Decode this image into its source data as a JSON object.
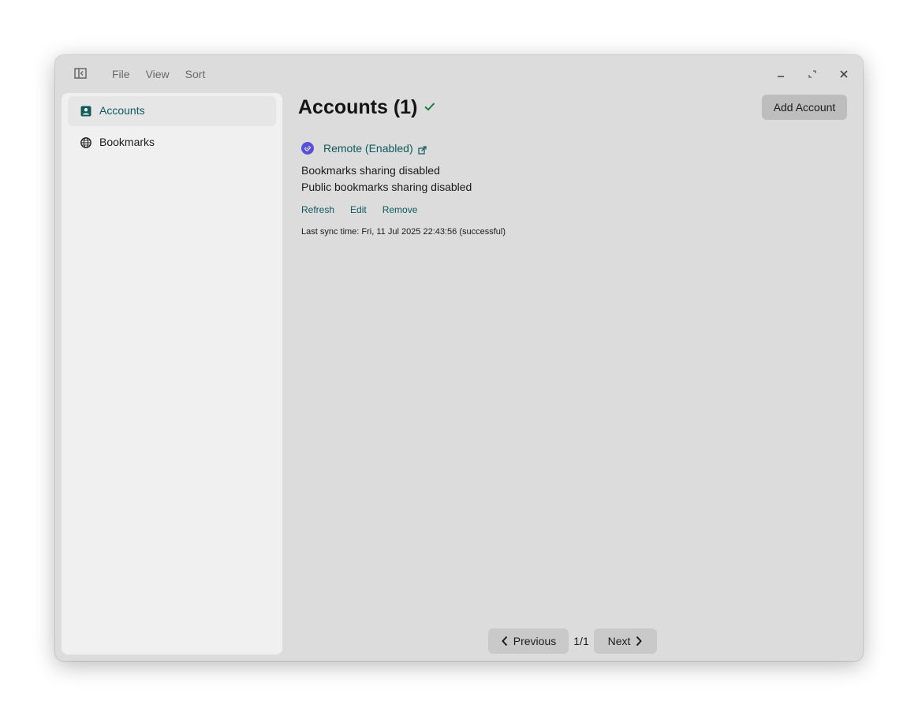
{
  "menu": {
    "items": [
      "File",
      "View",
      "Sort"
    ]
  },
  "sidebar": {
    "items": [
      {
        "label": "Accounts",
        "icon": "account-box-icon",
        "active": true
      },
      {
        "label": "Bookmarks",
        "icon": "globe-icon",
        "active": false
      }
    ]
  },
  "main": {
    "title": "Accounts (1)",
    "add_account_label": "Add Account",
    "account": {
      "name": "Remote (Enabled)",
      "icon": "link-icon",
      "bookmarks_sharing": "Bookmarks sharing disabled",
      "public_bookmarks_sharing": "Public bookmarks sharing disabled",
      "actions": [
        "Refresh",
        "Edit",
        "Remove"
      ],
      "last_sync": "Last sync time: Fri, 11 Jul 2025 22:43:56 (successful)"
    }
  },
  "pagination": {
    "previous_label": "Previous",
    "page_indicator": "1/1",
    "next_label": "Next"
  },
  "colors": {
    "accent": "#0e5a5c",
    "success_check": "#1e7a3a",
    "account_icon_bg": "#5a4fd9",
    "window_bg": "#dcdcdc",
    "sidebar_bg": "#f0f0f0"
  }
}
